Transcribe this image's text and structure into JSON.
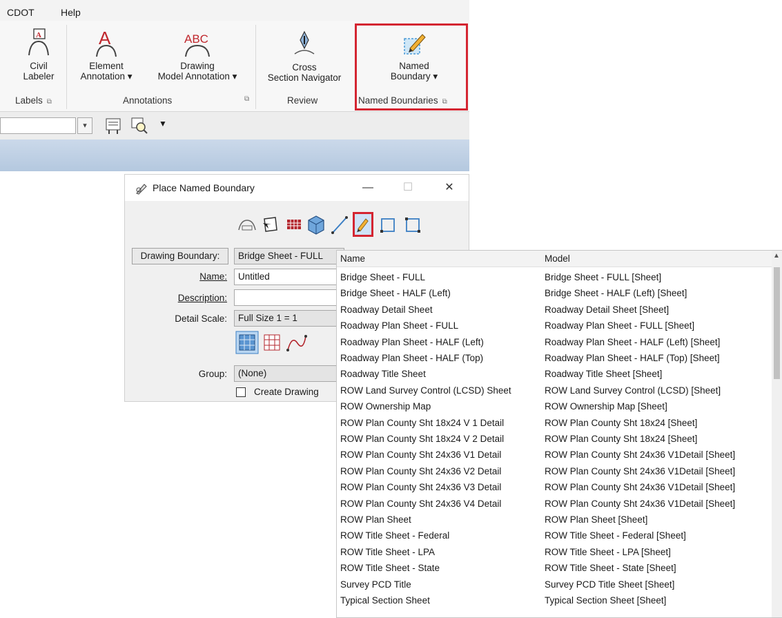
{
  "menu": {
    "items": [
      "CDOT",
      "Help"
    ]
  },
  "ribbon": {
    "buttons": {
      "civil_labeler": "Civil\nLabeler",
      "element_annotation": "Element\nAnnotation ▾",
      "drawing_model_annotation": "Drawing\nModel Annotation ▾",
      "cross_section_navigator": "Cross\nSection Navigator",
      "named_boundary": "Named\nBoundary ▾"
    },
    "groups": {
      "labels": "Labels",
      "annotations": "Annotations",
      "review": "Review",
      "named_boundaries": "Named Boundaries"
    },
    "highlight_color": "#d42531"
  },
  "dialog": {
    "title": "Place Named Boundary",
    "controls": {
      "minimize": "—",
      "maximize": "☐",
      "close": "✕"
    },
    "tools": [
      "civil-template-icon",
      "select-icon",
      "grid-icon",
      "cube-icon",
      "line-icon",
      "pencil-icon",
      "rectangle-icon",
      "rectangle-corners-icon"
    ],
    "selected_tool": "pencil-icon",
    "fields": {
      "drawing_boundary_label": "Drawing Boundary:",
      "drawing_boundary_value": "Bridge Sheet - FULL",
      "name_label": "Name:",
      "name_value": "Untitled",
      "description_label": "Description:",
      "description_value": "",
      "detail_scale_label": "Detail Scale:",
      "detail_scale_value": "Full Size 1 = 1",
      "group_label": "Group:",
      "group_value": "(None)",
      "create_drawing_label": "Create Drawing"
    }
  },
  "list": {
    "columns": [
      "Name",
      "Model"
    ],
    "rows": [
      [
        "Bridge Sheet - FULL",
        "Bridge Sheet - FULL [Sheet]"
      ],
      [
        "Bridge Sheet - HALF (Left)",
        "Bridge Sheet - HALF (Left) [Sheet]"
      ],
      [
        "Roadway Detail Sheet",
        "Roadway Detail Sheet [Sheet]"
      ],
      [
        "Roadway Plan Sheet - FULL",
        "Roadway Plan Sheet - FULL [Sheet]"
      ],
      [
        "Roadway Plan Sheet - HALF (Left)",
        "Roadway Plan Sheet - HALF (Left) [Sheet]"
      ],
      [
        "Roadway Plan Sheet - HALF (Top)",
        "Roadway Plan Sheet - HALF (Top) [Sheet]"
      ],
      [
        "Roadway Title Sheet",
        "Roadway Title Sheet [Sheet]"
      ],
      [
        "ROW Land Survey Control (LCSD) Sheet",
        "ROW Land Survey Control (LCSD) [Sheet]"
      ],
      [
        "ROW Ownership Map",
        "ROW Ownership Map [Sheet]"
      ],
      [
        "ROW Plan County Sht 18x24 V 1 Detail",
        "ROW Plan County Sht 18x24 [Sheet]"
      ],
      [
        "ROW Plan County Sht 18x24 V 2 Detail",
        "ROW Plan County Sht 18x24 [Sheet]"
      ],
      [
        "ROW Plan County Sht 24x36 V1 Detail",
        "ROW Plan County Sht 24x36 V1Detail [Sheet]"
      ],
      [
        "ROW Plan County Sht 24x36 V2 Detail",
        "ROW Plan County Sht 24x36 V1Detail [Sheet]"
      ],
      [
        "ROW Plan County Sht 24x36 V3 Detail",
        "ROW Plan County Sht 24x36 V1Detail [Sheet]"
      ],
      [
        "ROW Plan County Sht 24x36 V4 Detail",
        "ROW Plan County Sht 24x36 V1Detail [Sheet]"
      ],
      [
        "ROW Plan Sheet",
        "ROW Plan Sheet [Sheet]"
      ],
      [
        "ROW Title Sheet - Federal",
        "ROW Title Sheet - Federal [Sheet]"
      ],
      [
        "ROW Title Sheet - LPA",
        "ROW Title Sheet - LPA [Sheet]"
      ],
      [
        "ROW Title Sheet - State",
        "ROW Title Sheet - State [Sheet]"
      ],
      [
        "Survey PCD Title",
        "Survey PCD Title Sheet [Sheet]"
      ],
      [
        "Typical Section Sheet",
        "Typical Section Sheet [Sheet]"
      ]
    ]
  }
}
